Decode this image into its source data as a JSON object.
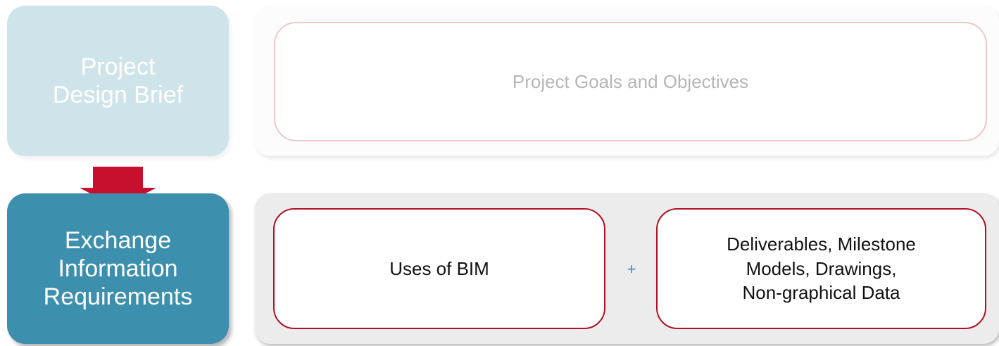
{
  "design_brief": {
    "lines": [
      "Project",
      "Design Brief"
    ],
    "color": "#cfe4ea"
  },
  "eir": {
    "lines": [
      "Exchange",
      "Information",
      "Requirements"
    ],
    "color": "#3d8fae"
  },
  "arrow": {
    "icon": "arrow-down-icon",
    "color": "#c8102e"
  },
  "goals": {
    "label": "Project Goals and Objectives",
    "border_color": "#efc7c9"
  },
  "uses": {
    "label": "Uses of BIM",
    "border_color": "#b30f24"
  },
  "connector": {
    "symbol": "+"
  },
  "deliverables": {
    "lines": [
      "Deliverables, Milestone",
      "Models, Drawings,",
      "Non-graphical Data"
    ],
    "border_color": "#b30f24"
  }
}
